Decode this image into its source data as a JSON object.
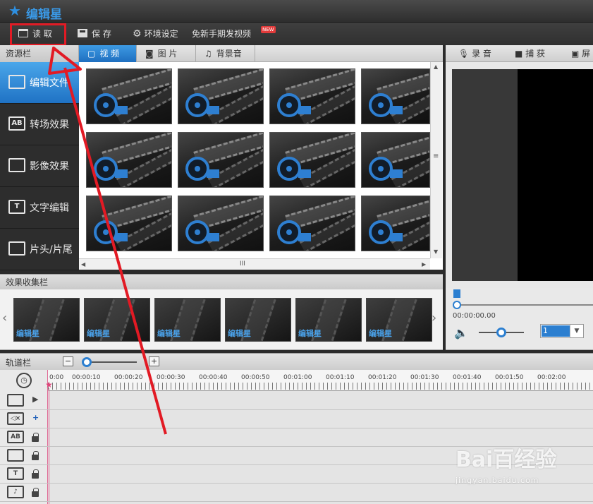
{
  "app": {
    "title": "编辑星"
  },
  "menu": {
    "read": "读 取",
    "save": "保 存",
    "settings": "环境设定",
    "promo": "免新手期发视频",
    "new_badge": "NEW"
  },
  "resource": {
    "header": "资源栏",
    "tabs": [
      "视 频",
      "图 片",
      "背景音乐"
    ],
    "sidebar": [
      "编辑文件",
      "转场效果",
      "影像效果",
      "文字编辑",
      "片头/片尾"
    ]
  },
  "effects": {
    "header": "效果收集栏",
    "thumb_label": "编辑星"
  },
  "preview": {
    "tabs": [
      "录 音",
      "捕 获",
      "屏幕"
    ],
    "timecode": "00:00:00.00",
    "speed": "1"
  },
  "track": {
    "header": "轨道栏",
    "zoom_minus": "−",
    "zoom_plus": "+",
    "ruler": [
      "0:00",
      "00:00:10",
      "00:00:20",
      "00:00:30",
      "00:00:40",
      "00:00:50",
      "00:01:00",
      "00:01:10",
      "00:01:20",
      "00:01:30",
      "00:01:40",
      "00:01:50",
      "00:02:00"
    ]
  },
  "watermark": {
    "main": "Bai百经验",
    "sub": "jingyan.baidu.com"
  },
  "colors": {
    "accent": "#2c7fd0",
    "highlight": "#e21a24",
    "cursor": "#e06a95"
  }
}
